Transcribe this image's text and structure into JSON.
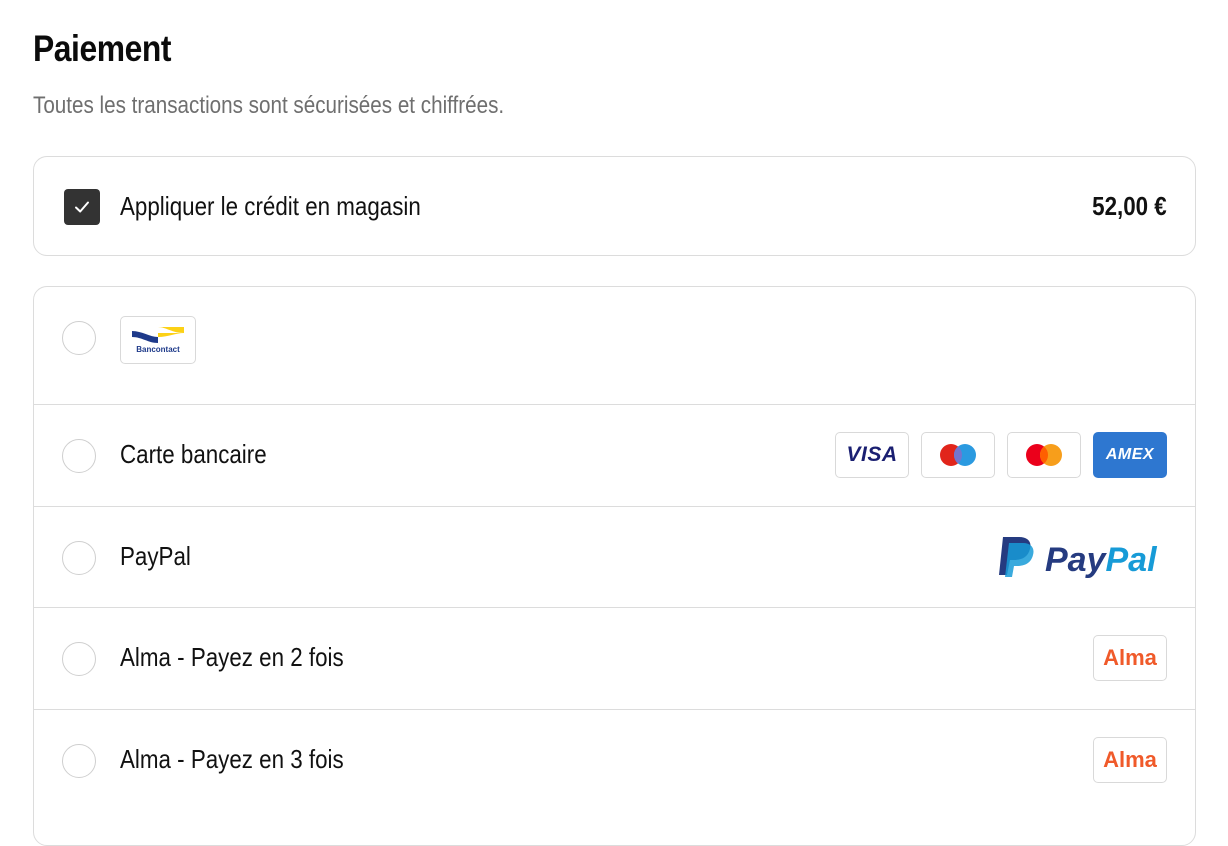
{
  "header": {
    "title": "Paiement",
    "subtitle": "Toutes les transactions sont sécurisées et chiffrées."
  },
  "store_credit": {
    "label": "Appliquer le crédit en magasin",
    "amount": "52,00 €",
    "checked": true,
    "icon": "checkmark-icon"
  },
  "methods": [
    {
      "label": "",
      "logos": [
        {
          "name": "bancontact-logo",
          "text": "Bancontact"
        }
      ]
    },
    {
      "label": "Carte bancaire",
      "logos": [
        {
          "name": "visa-logo",
          "text": "VISA"
        },
        {
          "name": "maestro-logo",
          "text": ""
        },
        {
          "name": "mastercard-logo",
          "text": ""
        },
        {
          "name": "amex-logo",
          "text": "AMEX"
        }
      ]
    },
    {
      "label": "PayPal",
      "logos": [
        {
          "name": "paypal-logo",
          "text": "PayPal"
        }
      ]
    },
    {
      "label": "Alma - Payez en 2 fois",
      "logos": [
        {
          "name": "alma-logo",
          "text": "Alma"
        }
      ]
    },
    {
      "label": "Alma - Payez en 3 fois",
      "logos": [
        {
          "name": "alma-logo",
          "text": "Alma"
        }
      ]
    }
  ],
  "colors": {
    "checkbox": "#333333",
    "border": "#dcdcdc",
    "subtitle": "#6f6f6f",
    "alma": "#f05a2a",
    "paypal_dark": "#253b80",
    "paypal_light": "#179bd7",
    "amex": "#2e77d0",
    "visa": "#1a1f71",
    "bancontact_blue": "#1e3a8a",
    "bancontact_yellow": "#fcd116"
  }
}
